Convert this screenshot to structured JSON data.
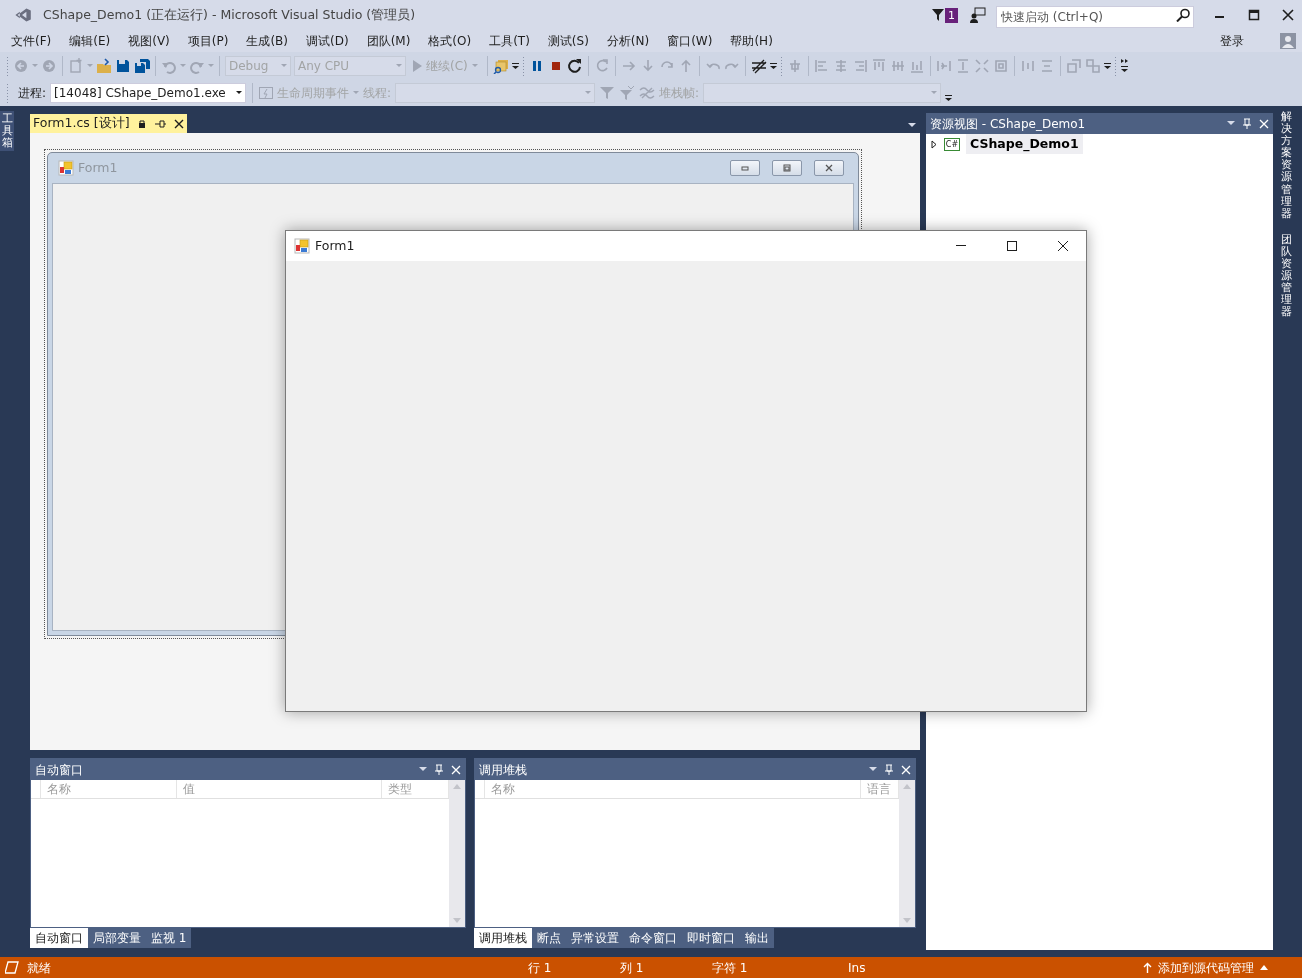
{
  "window": {
    "title": "CShape_Demo1 (正在运行) - Microsoft Visual Studio (管理员)"
  },
  "notifications": {
    "count": "1"
  },
  "quick_launch": {
    "placeholder": "快速启动 (Ctrl+Q)"
  },
  "menu": [
    "文件(F)",
    "编辑(E)",
    "视图(V)",
    "项目(P)",
    "生成(B)",
    "调试(D)",
    "团队(M)",
    "格式(O)",
    "工具(T)",
    "测试(S)",
    "分析(N)",
    "窗口(W)",
    "帮助(H)"
  ],
  "sign_in": "登录",
  "toolbar": {
    "configuration": {
      "value": "Debug",
      "disabled": true
    },
    "platform": {
      "value": "Any CPU",
      "disabled": true
    },
    "continue": {
      "label": "继续(C)",
      "disabled": true
    }
  },
  "debug_location": {
    "process_label": "进程:",
    "process": "[14048] CShape_Demo1.exe",
    "lifecycle": "生命周期事件",
    "thread_label": "线程:",
    "stack_frame_label": "堆栈帧:"
  },
  "left_strip": [
    "工具箱"
  ],
  "document_tab": {
    "title": "Form1.cs [设计]",
    "selected": true
  },
  "designer_form": {
    "title": "Form1"
  },
  "running_form": {
    "title": "Form1"
  },
  "resource_view": {
    "title": "资源视图 - CShape_Demo1",
    "tree": [
      {
        "label": "CShape_Demo1",
        "icon_text": "C#",
        "expanded": false
      }
    ]
  },
  "right_strip": [
    "解决方案资源管理器",
    "团队资源管理器"
  ],
  "autos": {
    "title": "自动窗口",
    "columns": [
      "名称",
      "值",
      "类型"
    ],
    "tabs": [
      {
        "label": "自动窗口",
        "selected": true
      },
      {
        "label": "局部变量",
        "selected": false
      },
      {
        "label": "监视 1",
        "selected": false
      }
    ]
  },
  "call_stack": {
    "title": "调用堆栈",
    "columns": [
      "名称",
      "语言"
    ],
    "tabs": [
      {
        "label": "调用堆栈",
        "selected": true
      },
      {
        "label": "断点",
        "selected": false
      },
      {
        "label": "异常设置",
        "selected": false
      },
      {
        "label": "命令窗口",
        "selected": false
      },
      {
        "label": "即时窗口",
        "selected": false
      },
      {
        "label": "输出",
        "selected": false
      }
    ]
  },
  "status_bar": {
    "state": "就绪",
    "line": "行 1",
    "column": "列 1",
    "char": "字符 1",
    "mode": "Ins",
    "source_control": "添加到源代码管理"
  }
}
